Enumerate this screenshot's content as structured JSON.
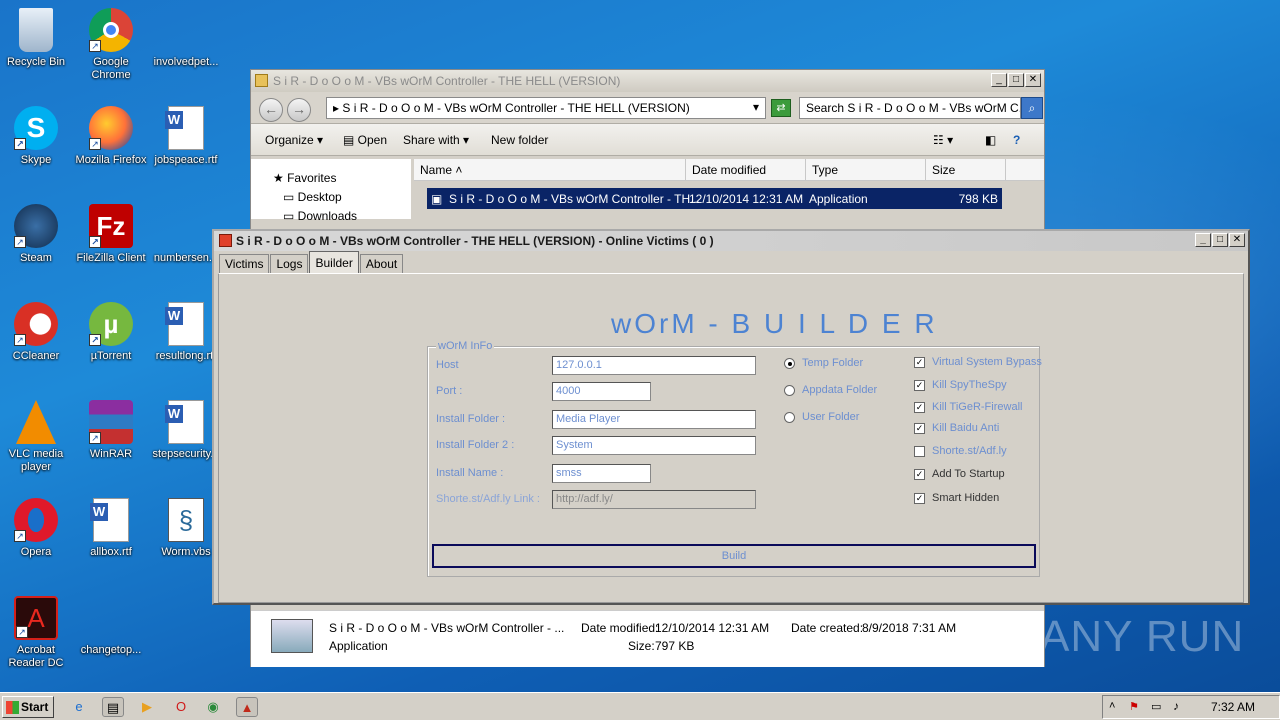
{
  "desktop": {
    "icons": [
      {
        "label": "Recycle Bin"
      },
      {
        "label": "Google Chrome"
      },
      {
        "label": "involvedpet..."
      },
      {
        "label": "Skype"
      },
      {
        "label": "Mozilla Firefox"
      },
      {
        "label": "jobspeace.rtf"
      },
      {
        "label": "Steam"
      },
      {
        "label": "FileZilla Client"
      },
      {
        "label": "numbersen..."
      },
      {
        "label": "CCleaner"
      },
      {
        "label": "µTorrent"
      },
      {
        "label": "resultlong.rtf"
      },
      {
        "label": "VLC media player"
      },
      {
        "label": "WinRAR"
      },
      {
        "label": "stepsecurity..."
      },
      {
        "label": "Opera"
      },
      {
        "label": "allbox.rtf"
      },
      {
        "label": "Worm.vbs"
      },
      {
        "label": "Acrobat Reader DC"
      },
      {
        "label": "changetop..."
      }
    ]
  },
  "explorer": {
    "title": "S i R - D o O o M  - VBs wOrM Controller - THE HELL (VERSION)",
    "address": "S i R - D o O o M  - VBs wOrM Controller - THE HELL (VERSION)",
    "search_placeholder": "Search S i R - D o O o M  - VBs wOrM C...",
    "toolbar": {
      "organize": "Organize",
      "open": "Open",
      "share_with": "Share with",
      "new_folder": "New folder"
    },
    "nav": {
      "favorites": "Favorites",
      "desktop": "Desktop",
      "downloads": "Downloads"
    },
    "columns": {
      "name": "Name",
      "date_modified": "Date modified",
      "type": "Type",
      "size": "Size"
    },
    "file": {
      "name": "S i R - D o O o M  - VBs wOrM Controller - TH...",
      "date": "12/10/2014 12:31 AM",
      "type": "Application",
      "size": "798 KB"
    },
    "details": {
      "name": "S i R - D o O o M  - VBs wOrM Controller - ...",
      "type": "Application",
      "date_modified_label": "Date modified:",
      "date_modified": "12/10/2014 12:31 AM",
      "date_created_label": "Date created:",
      "date_created": "8/9/2018 7:31 AM",
      "size_label": "Size:",
      "size": "797 KB"
    }
  },
  "worm": {
    "title": "S i R - D o O o M  - VBs wOrM Controller - THE HELL (VERSION) - Online Victims ( 0 )",
    "tabs": [
      "Victims",
      "Logs",
      "Builder",
      "About"
    ],
    "heading": "wOrM - B U I L D E R",
    "group_label": "wOrM InFo",
    "fields": {
      "host_label": "Host",
      "host": "127.0.0.1",
      "port_label": "Port :",
      "port": "4000",
      "install_folder_label": "Install Folder :",
      "install_folder": "Media Player",
      "install_folder2_label": "Install Folder 2 :",
      "install_folder2": "System",
      "install_name_label": "Install Name :",
      "install_name": "smss",
      "link_label": "Shorte.st/Adf.ly Link :",
      "link": "http://adf.ly/"
    },
    "radios": [
      "Temp Folder",
      "Appdata Folder",
      "User Folder"
    ],
    "checks": [
      "Virtual System Bypass",
      "Kill SpyTheSpy",
      "Kill TiGeR-Firewall",
      "Kill Baidu Anti",
      "Shorte.st/Adf.ly",
      "Add To Startup",
      "Smart Hidden"
    ],
    "build_label": "Build"
  },
  "taskbar": {
    "start": "Start",
    "clock": "7:32 AM"
  },
  "watermark": "ANY RUN"
}
